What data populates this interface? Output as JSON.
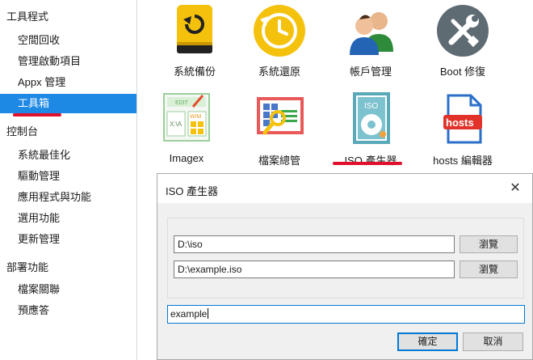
{
  "sidebar": {
    "sections": [
      {
        "label": "工具程式",
        "items": [
          "空間回收",
          "管理啟動項目",
          "Appx 管理",
          "工具箱"
        ]
      },
      {
        "label": "控制台",
        "items": [
          "系統最佳化",
          "驅動管理",
          "應用程式與功能",
          "選用功能",
          "更新管理"
        ]
      },
      {
        "label": "部署功能",
        "items": [
          "檔案關聯",
          "預應答"
        ]
      }
    ],
    "selected": "工具箱"
  },
  "tools": [
    {
      "label": "系統備份",
      "icon": "backup-drive-icon"
    },
    {
      "label": "系統還原",
      "icon": "restore-clock-icon"
    },
    {
      "label": "帳戶管理",
      "icon": "users-icon"
    },
    {
      "label": "Boot 修復",
      "icon": "wrench-screwdriver-icon"
    },
    {
      "label": "Imagex",
      "icon": "imagex-icon"
    },
    {
      "label": "檔案總管",
      "icon": "file-explorer-icon"
    },
    {
      "label": "ISO 產生器",
      "icon": "iso-disc-icon"
    },
    {
      "label": "hosts 編輯器",
      "icon": "hosts-file-icon"
    }
  ],
  "icon_texts": {
    "edit": "EDIT",
    "xa": "X:\\A",
    "wim": "WIM",
    "iso": "ISO",
    "hosts": "hosts"
  },
  "dialog": {
    "title": "ISO 產生器",
    "close_glyph": "✕",
    "source_path": "D:\\iso",
    "output_path": "D:\\example.iso",
    "browse_label": "瀏覽",
    "name_value": "example",
    "ok_label": "確定",
    "cancel_label": "取消"
  },
  "colors": {
    "accent": "#1e88e5",
    "highlight_red": "#e0102c"
  }
}
